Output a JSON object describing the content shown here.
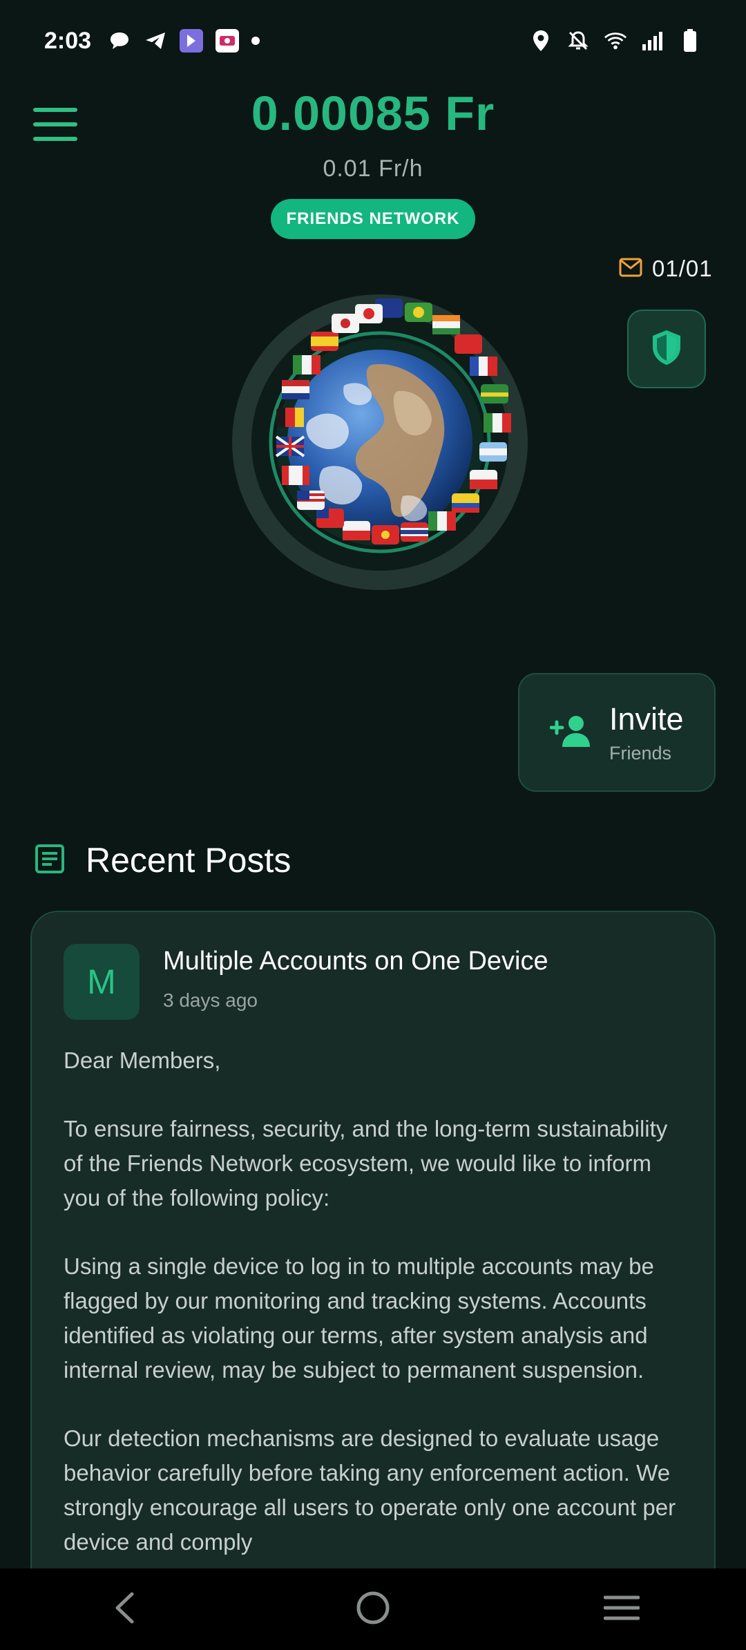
{
  "status_bar": {
    "time": "2:03",
    "left_icons": [
      "chat-bubble-icon",
      "telegram-icon",
      "app-icon-purple",
      "app-icon-badge",
      "dot-icon"
    ],
    "right_icons": [
      "location-icon",
      "bell-off-icon",
      "wifi-icon",
      "signal-icon",
      "battery-icon"
    ]
  },
  "header": {
    "balance": "0.00085 Fr",
    "rate": "0.01 Fr/h",
    "network_badge": "FRIENDS NETWORK",
    "mail_count": "01/01",
    "menu_icon": "hamburger-menu-icon",
    "shield_icon": "shield-icon",
    "mail_icon": "mail-icon"
  },
  "globe": {
    "label": "earth-globe-with-flags"
  },
  "invite": {
    "title": "Invite",
    "subtitle": "Friends",
    "icon": "add-person-icon"
  },
  "recent_posts": {
    "title": "Recent Posts",
    "icon": "document-icon",
    "posts": [
      {
        "avatar_letter": "M",
        "title": "Multiple Accounts on One Device",
        "time": "3 days ago",
        "paragraphs": [
          "Dear Members,",
          "To ensure fairness, security, and the long-term sustainability of the Friends Network ecosystem, we would like to inform you of the following policy:",
          "Using a single device to log in to multiple accounts may be flagged by our monitoring and tracking systems. Accounts identified as violating our terms, after system analysis and internal review, may be subject to permanent suspension.",
          "Our detection mechanisms are designed to evaluate usage behavior carefully before taking any enforcement action. We strongly encourage all users to operate only one account per device and comply"
        ]
      }
    ]
  },
  "colors": {
    "background": "#0b1714",
    "accent_green": "#27b780",
    "badge_green": "#12b67e",
    "mail_orange": "#f0a23a",
    "card_bg": "#172b27"
  },
  "nav": {
    "back_icon": "back-chevron-icon",
    "home_icon": "home-circle-icon",
    "recents_icon": "recents-menu-icon"
  }
}
